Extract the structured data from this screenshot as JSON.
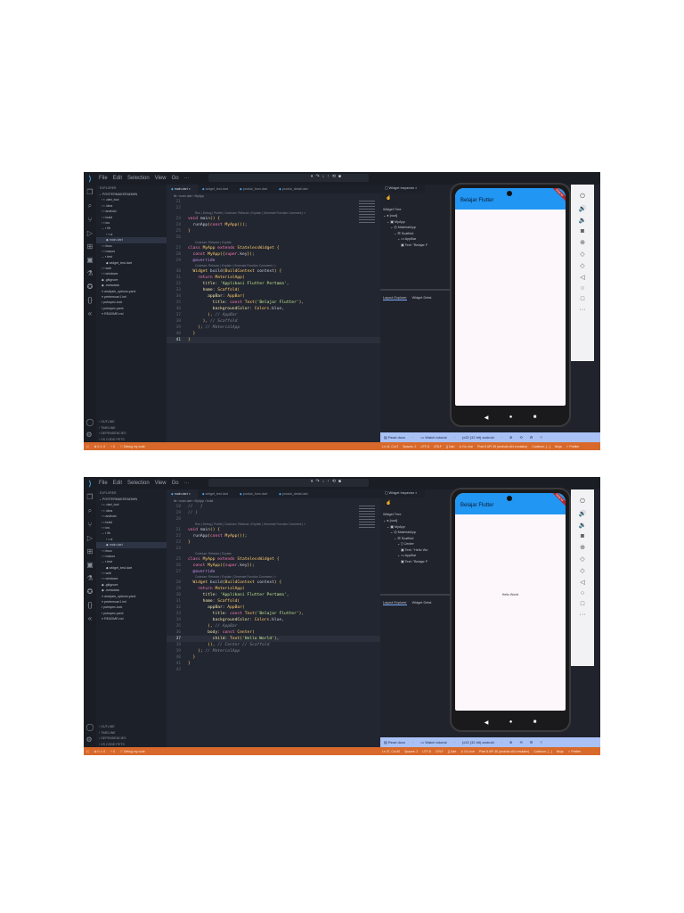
{
  "colors": {
    "accent": "#2196f3",
    "status_bar": "#d8692b",
    "bottom_bar": "#a9c1f5"
  },
  "shots": [
    {
      "menu": [
        "File",
        "Edit",
        "Selection",
        "View",
        "Go",
        "···"
      ],
      "explorer_title": "EXPLORER",
      "project": "POSTERMAKERADMIN",
      "files": [
        {
          "d": 0,
          "t": "› ▪ .dart_tool"
        },
        {
          "d": 0,
          "t": "› ▪ .idea"
        },
        {
          "d": 0,
          "t": "› ▪ android"
        },
        {
          "d": 0,
          "t": "› ▪ build"
        },
        {
          "d": 0,
          "t": "› ▪ ios"
        },
        {
          "d": 0,
          "t": "⌄ ▪ lib"
        },
        {
          "d": 1,
          "t": "› ▪ ui"
        },
        {
          "d": 1,
          "t": "◆ main.dart",
          "sel": true
        },
        {
          "d": 0,
          "t": "› ▪ linux"
        },
        {
          "d": 0,
          "t": "› ▪ macos"
        },
        {
          "d": 0,
          "t": "⌄ ▪ test"
        },
        {
          "d": 1,
          "t": "◆ widget_test.dart"
        },
        {
          "d": 0,
          "t": "› ▪ web"
        },
        {
          "d": 0,
          "t": "› ▪ windows"
        },
        {
          "d": 0,
          "t": "◆ .gitignore"
        },
        {
          "d": 0,
          "t": "◆ .metadata"
        },
        {
          "d": 0,
          "t": "≡ analysis_options.yaml"
        },
        {
          "d": 0,
          "t": "≡ pertemuan1.iml"
        },
        {
          "d": 0,
          "t": "▪ pubspec.lock"
        },
        {
          "d": 0,
          "t": "▪ pubspec.yaml"
        },
        {
          "d": 0,
          "t": "≡ README.md"
        }
      ],
      "sections": [
        "› OUTLINE",
        "› TIMELINE",
        "› DEPENDENCIES",
        "› VS CODE PETS"
      ],
      "tabs": [
        "main.dart",
        "widget_test.dart",
        "produk_form.dart",
        "produk_detail.dart"
      ],
      "breadcrumb": "lib › main.dart › MyApp",
      "current_line": 41,
      "code": [
        {
          "n": 21,
          "t": ""
        },
        {
          "n": 22,
          "t": ""
        },
        {
          "lens": "Run | Debug | Profile | Codeium: Refactor | Explain | Generate Function Comment | ×"
        },
        {
          "n": 23,
          "t": "void main() {"
        },
        {
          "n": 24,
          "t": "  runApp(const MyApp());"
        },
        {
          "n": 25,
          "t": "}"
        },
        {
          "n": 26,
          "t": ""
        },
        {
          "lens": "Codeium: Refactor | Explain"
        },
        {
          "n": 27,
          "t": "class MyApp extends StatelessWidget {"
        },
        {
          "n": 28,
          "t": "  const MyApp({super.key});"
        },
        {
          "n": 29,
          "t": "  @override"
        },
        {
          "lens": "Codeium: Refactor | Explain | Generate Function Comment | ×"
        },
        {
          "n": 30,
          "t": "  Widget build(BuildContext context) {"
        },
        {
          "n": 31,
          "t": "    return MaterialApp("
        },
        {
          "n": 32,
          "t": "      title: 'Applikasi Flutter Pertama',"
        },
        {
          "n": 33,
          "t": "      home: Scaffold("
        },
        {
          "n": 34,
          "t": "        appBar: AppBar("
        },
        {
          "n": 35,
          "t": "          title: const Text('Belajar Flutter'),"
        },
        {
          "n": 36,
          "t": "          backgroundColor: Colors.blue,"
        },
        {
          "n": 37,
          "t": "        ), // AppBar"
        },
        {
          "n": 38,
          "t": "      ), // Scaffold"
        },
        {
          "n": 39,
          "t": "    ); // MaterialApp"
        },
        {
          "n": 40,
          "t": "  }"
        },
        {
          "n": 41,
          "t": "}"
        }
      ],
      "inspector_tab": "Widget Inspector",
      "tree_title": "Widget Tree",
      "tree": [
        {
          "d": 0,
          "t": "⌄ ● [root]"
        },
        {
          "d": 1,
          "t": "⌄ ▣ MyApp"
        },
        {
          "d": 2,
          "t": "⌄ ◎ MaterialApp"
        },
        {
          "d": 3,
          "t": "⌄ ☰ Scaffold"
        },
        {
          "d": 4,
          "t": "⌄ ▭ AppBar"
        },
        {
          "d": 5,
          "t": "▣ Text: \"Belajar F"
        }
      ],
      "lower_tabs": [
        "Layout Explorer",
        "Widget Detai"
      ],
      "app_title": "Belajar Flutter",
      "debug_banner": "DEBUG",
      "body_text": "",
      "bottom_bar": [
        "▤ Read docs",
        "·",
        "▭ Watch tutorial",
        "·",
        "(x32 (32 bit) android",
        "·",
        "✲",
        "⟲",
        "⚙",
        "?"
      ],
      "status_left": [
        "⊗ 0 ⚠ 0",
        "⑂ 0",
        "⚐ Debug my code"
      ],
      "status_right": [
        "Ln 41, Col 2",
        "Spaces: 2",
        "UTF-8",
        "CRLF",
        "{} Dart",
        "⊙ Go Live",
        "Pixel 8 API 35 (android-x64 emulator)",
        "Codeium: {...}",
        "Ninja",
        "✓ Prettier"
      ]
    },
    {
      "menu": [
        "File",
        "Edit",
        "Selection",
        "View",
        "Go",
        "···"
      ],
      "explorer_title": "EXPLORER",
      "project": "POSTERMAKERADMIN",
      "files": [
        {
          "d": 0,
          "t": "› ▪ .dart_tool"
        },
        {
          "d": 0,
          "t": "› ▪ .idea"
        },
        {
          "d": 0,
          "t": "› ▪ android"
        },
        {
          "d": 0,
          "t": "› ▪ build"
        },
        {
          "d": 0,
          "t": "› ▪ ios"
        },
        {
          "d": 0,
          "t": "⌄ ▪ lib"
        },
        {
          "d": 1,
          "t": "› ▪ ui"
        },
        {
          "d": 1,
          "t": "◆ main.dart",
          "sel": true
        },
        {
          "d": 0,
          "t": "› ▪ linux"
        },
        {
          "d": 0,
          "t": "› ▪ macos"
        },
        {
          "d": 0,
          "t": "⌄ ▪ test"
        },
        {
          "d": 1,
          "t": "◆ widget_test.dart"
        },
        {
          "d": 0,
          "t": "› ▪ web"
        },
        {
          "d": 0,
          "t": "› ▪ windows"
        },
        {
          "d": 0,
          "t": "◆ .gitignore"
        },
        {
          "d": 0,
          "t": "◆ .metadata"
        },
        {
          "d": 0,
          "t": "≡ analysis_options.yaml"
        },
        {
          "d": 0,
          "t": "≡ pertemuan1.iml"
        },
        {
          "d": 0,
          "t": "▪ pubspec.lock"
        },
        {
          "d": 0,
          "t": "▪ pubspec.yaml"
        },
        {
          "d": 0,
          "t": "≡ README.md"
        }
      ],
      "sections": [
        "› OUTLINE",
        "› TIMELINE",
        "› DEPENDENCIES",
        "› VS CODE PETS"
      ],
      "tabs": [
        "main.dart",
        "widget_test.dart",
        "produk_form.dart",
        "produk_detail.dart"
      ],
      "breadcrumb": "lib › main.dart › MyApp › build",
      "current_line": 37,
      "code": [
        {
          "n": 18,
          "t": "//   }"
        },
        {
          "n": 19,
          "t": "// }"
        },
        {
          "n": 20,
          "t": ""
        },
        {
          "lens": "Run | Debug | Profile | Codeium: Refactor | Explain | Generate Function Comment | ×"
        },
        {
          "n": 21,
          "t": "void main() {"
        },
        {
          "n": 22,
          "t": "  runApp(const MyApp());"
        },
        {
          "n": 23,
          "t": "}"
        },
        {
          "n": 24,
          "t": ""
        },
        {
          "lens": "Codeium: Refactor | Explain"
        },
        {
          "n": 25,
          "t": "class MyApp extends StatelessWidget {"
        },
        {
          "n": 26,
          "t": "  const MyApp({super.key});"
        },
        {
          "n": 27,
          "t": "  @override"
        },
        {
          "lens": "Codeium: Refactor | Explain | Generate Function Comment | ×"
        },
        {
          "n": 28,
          "t": "  Widget build(BuildContext context) {"
        },
        {
          "n": 29,
          "t": "    return MaterialApp("
        },
        {
          "n": 30,
          "t": "      title: 'Applikasi Flutter Pertama',"
        },
        {
          "n": 31,
          "t": "      home: Scaffold("
        },
        {
          "n": 32,
          "t": "        appBar: AppBar("
        },
        {
          "n": 33,
          "t": "          title: const Text('Belajar Flutter'),"
        },
        {
          "n": 34,
          "t": "          backgroundColor: Colors.blue,"
        },
        {
          "n": 35,
          "t": "        ), // AppBar"
        },
        {
          "n": 36,
          "t": "        body: const Center("
        },
        {
          "n": 37,
          "t": "          child: Text('Hello World'),"
        },
        {
          "n": 38,
          "t": "        )), // Center // Scaffold"
        },
        {
          "n": 39,
          "t": "    ); // MaterialApp"
        },
        {
          "n": 40,
          "t": "  }"
        },
        {
          "n": 41,
          "t": "}"
        },
        {
          "n": 42,
          "t": ""
        }
      ],
      "inspector_tab": "Widget Inspector",
      "tree_title": "Widget Tree",
      "tree": [
        {
          "d": 0,
          "t": "⌄ ● [root]"
        },
        {
          "d": 1,
          "t": "⌄ ▣ MyApp"
        },
        {
          "d": 2,
          "t": "⌄ ◎ MaterialApp"
        },
        {
          "d": 3,
          "t": "⌄ ☰ Scaffold"
        },
        {
          "d": 4,
          "t": "⌄ ▯ Center"
        },
        {
          "d": 5,
          "t": "▣ Text: \"Hello Wo"
        },
        {
          "d": 4,
          "t": "⌄ ▭ AppBar"
        },
        {
          "d": 5,
          "t": "▣ Text: \"Belajar F"
        }
      ],
      "lower_tabs": [
        "Layout Explorer",
        "Widget Detai"
      ],
      "app_title": "Belajar Flutter",
      "debug_banner": "DEBUG",
      "body_text": "Hello World",
      "bottom_bar": [
        "▤ Read docs",
        "·",
        "▭ Watch tutorial",
        "·",
        "(x32 (32 bit) android",
        "·",
        "✲",
        "⟲",
        "⚙",
        "?"
      ],
      "status_left": [
        "⊗ 0 ⚠ 0",
        "⑂ 0",
        "⚐ Debug my code"
      ],
      "status_right": [
        "Ln 37, Col 40",
        "Spaces: 2",
        "UTF-8",
        "CRLF",
        "{} Dart",
        "⊙ Go Live",
        "Pixel 8 API 35 (android-x64 emulator)",
        "Codeium: {...}",
        "Ninja",
        "✓ Prettier"
      ]
    }
  ]
}
